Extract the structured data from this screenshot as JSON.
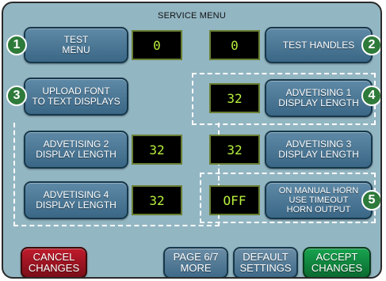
{
  "title": "SERVICE MENU",
  "rows": [
    {
      "left_label": "TEST\nMENU",
      "left_value": "0",
      "right_value": "0",
      "right_label": "TEST HANDLES"
    },
    {
      "left_label": "UPLOAD FONT\nTO TEXT DISPLAYS",
      "right_value": "32",
      "right_label": "ADVETISING 1\nDISPLAY LENGTH"
    },
    {
      "left_label": "ADVETISING 2\nDISPLAY LENGTH",
      "left_value": "32",
      "right_value": "32",
      "right_label": "ADVETISING 3\nDISPLAY LENGTH"
    },
    {
      "left_label": "ADVETISING 4\nDISPLAY LENGTH",
      "left_value": "32",
      "right_value": "OFF",
      "right_label": "ON MANUAL HORN\nUSE TIMEOUT\nHORN OUTPUT"
    }
  ],
  "badges": [
    "1",
    "2",
    "3",
    "4",
    "5"
  ],
  "bottom": {
    "cancel": "CANCEL\nCHANGES",
    "page": "PAGE 6/7\nMORE",
    "default": "DEFAULT\nSETTINGS",
    "accept": "ACCEPT\nCHANGES"
  },
  "colors": {
    "background": "#93b6c3",
    "button": "#4a7898",
    "value_text": "#b8f03c",
    "badge": "#2e7a3a",
    "cancel": "#a3182a",
    "accept": "#139145"
  }
}
